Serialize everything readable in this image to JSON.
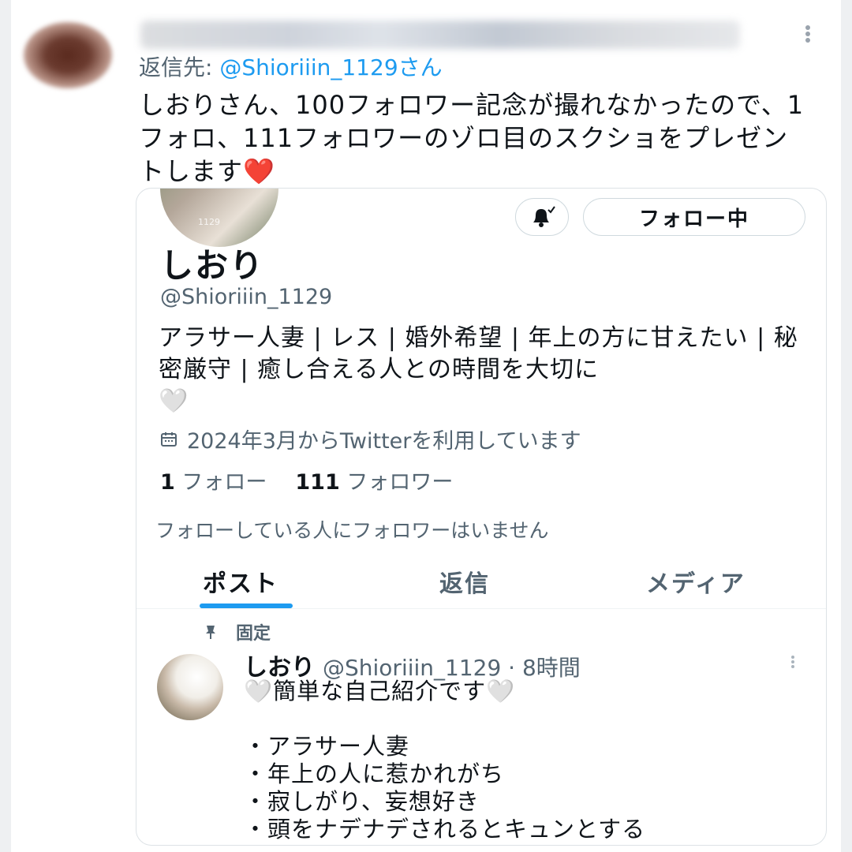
{
  "reply": {
    "reply_to_label": "返信先: ",
    "reply_to_handle": "@Shioriiin_1129さん",
    "text": "しおりさん、100フォロワー記念が撮れなかったので、1フォロ、111フォロワーのゾロ目のスクショをプレゼントします",
    "emoji": "❤️"
  },
  "profile": {
    "follow_button": "フォロー中",
    "name": "しおり",
    "handle": "@Shioriiin_1129",
    "bio": "アラサー人妻 | レス | 婚外希望 | 年上の方に甘えたい | 秘密厳守 | 癒し合える人との時間を大切に",
    "bio_emoji": "🤍",
    "joined": "2024年3月からTwitterを利用しています",
    "following_count": "1",
    "following_label": "フォロー",
    "followers_count": "111",
    "followers_label": "フォロワー",
    "no_followers_notice": "フォローしている人にフォロワーはいません"
  },
  "tabs": [
    {
      "label": "ポスト",
      "active": true
    },
    {
      "label": "返信",
      "active": false
    },
    {
      "label": "メディア",
      "active": false
    }
  ],
  "pinned_post": {
    "pinned_label": "固定",
    "author_name": "しおり",
    "author_meta": "@Shioriiin_1129 · 8時間",
    "title": "🤍簡単な自己紹介です🤍",
    "lines": [
      "・アラサー人妻",
      "・年上の人に惹かれがち",
      "・寂しがり、妄想好き",
      "・頭をナデナデされるとキュンとする"
    ]
  },
  "icons": {
    "overflow": "more-vertical-icon",
    "bell": "bell-check-icon",
    "calendar": "calendar-icon",
    "pin": "pin-icon"
  },
  "colors": {
    "accent": "#1d9bf0",
    "text_primary": "#0f1419",
    "text_secondary": "#536471",
    "heart": "#e0245e"
  }
}
